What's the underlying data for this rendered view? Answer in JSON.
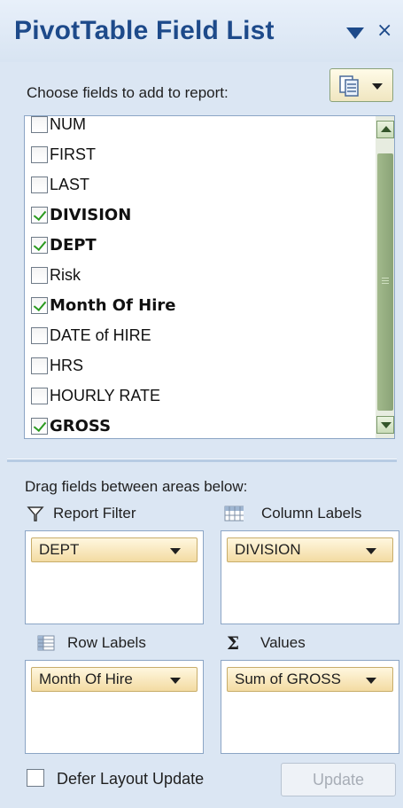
{
  "header": {
    "title": "PivotTable Field List"
  },
  "chooser": {
    "label": "Choose fields to add to report:"
  },
  "fields": [
    {
      "label": "NUM",
      "checked": false
    },
    {
      "label": "FIRST",
      "checked": false
    },
    {
      "label": "LAST",
      "checked": false
    },
    {
      "label": "DIVISION",
      "checked": true
    },
    {
      "label": "DEPT",
      "checked": true
    },
    {
      "label": "Risk",
      "checked": false
    },
    {
      "label": "Month Of Hire",
      "checked": true
    },
    {
      "label": "DATE of HIRE",
      "checked": false
    },
    {
      "label": "HRS",
      "checked": false
    },
    {
      "label": "HOURLY RATE",
      "checked": false
    },
    {
      "label": "GROSS",
      "checked": true
    }
  ],
  "areas": {
    "drag_label": "Drag fields between areas below:",
    "report_filter": {
      "label": "Report Filter",
      "icon": "filter-icon",
      "item": "DEPT"
    },
    "column_labels": {
      "label": "Column Labels",
      "icon": "column-grid-icon",
      "item": "DIVISION"
    },
    "row_labels": {
      "label": "Row Labels",
      "icon": "row-grid-icon",
      "item": "Month Of Hire"
    },
    "values": {
      "label": "Values",
      "icon": "sigma-icon",
      "item": "Sum of GROSS"
    }
  },
  "footer": {
    "defer_label": "Defer Layout Update",
    "defer_checked": false,
    "update_label": "Update"
  },
  "colors": {
    "title": "#1d4a8a",
    "pane_background": "#dbe6f3",
    "check_green": "#2a9a1f",
    "chip_gold": "#f3dba2"
  }
}
